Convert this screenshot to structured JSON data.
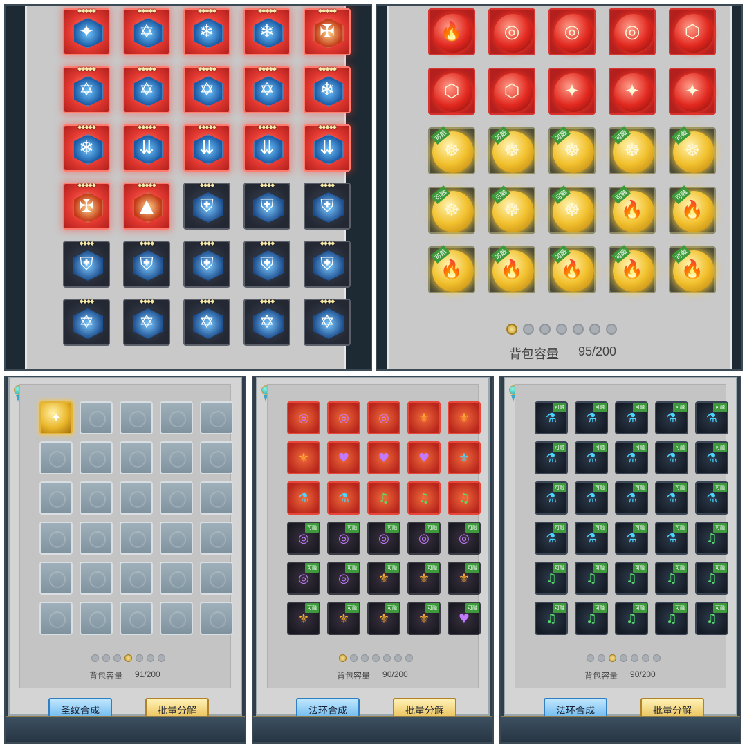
{
  "panels": {
    "p1": {
      "tiles": [
        {
          "style": "red",
          "symbol": "✦",
          "stars": "◆◆◆◆◆"
        },
        {
          "style": "red",
          "symbol": "✡",
          "stars": "◆◆◆◆◆"
        },
        {
          "style": "red",
          "symbol": "❄",
          "stars": "◆◆◆◆◆"
        },
        {
          "style": "red",
          "symbol": "❄",
          "stars": "◆◆◆◆◆"
        },
        {
          "style": "redfire",
          "symbol": "✠",
          "stars": "◆◆◆◆◆"
        },
        {
          "style": "red",
          "symbol": "✡",
          "stars": "◆◆◆◆◆"
        },
        {
          "style": "red",
          "symbol": "✡",
          "stars": "◆◆◆◆◆"
        },
        {
          "style": "red",
          "symbol": "✡",
          "stars": "◆◆◆◆◆"
        },
        {
          "style": "red",
          "symbol": "✡",
          "stars": "◆◆◆◆◆"
        },
        {
          "style": "red",
          "symbol": "❄",
          "stars": "◆◆◆◆◆"
        },
        {
          "style": "red",
          "symbol": "❄",
          "stars": "◆◆◆◆◆"
        },
        {
          "style": "red",
          "symbol": "⇊",
          "stars": "◆◆◆◆◆"
        },
        {
          "style": "red",
          "symbol": "⇊",
          "stars": "◆◆◆◆◆"
        },
        {
          "style": "red",
          "symbol": "⇊",
          "stars": "◆◆◆◆◆"
        },
        {
          "style": "red",
          "symbol": "⇊",
          "stars": "◆◆◆◆◆"
        },
        {
          "style": "redfire",
          "symbol": "✠",
          "stars": "◆◆◆◆◆"
        },
        {
          "style": "redfire",
          "symbol": "▲",
          "stars": "◆◆◆◆◆"
        },
        {
          "style": "dark",
          "symbol": "⛨",
          "stars": "◆◆◆◆"
        },
        {
          "style": "dark",
          "symbol": "⛨",
          "stars": "◆◆◆◆"
        },
        {
          "style": "dark",
          "symbol": "⛨",
          "stars": "◆◆◆◆"
        },
        {
          "style": "dark",
          "symbol": "⛨",
          "stars": "◆◆◆◆"
        },
        {
          "style": "dark",
          "symbol": "⛨",
          "stars": "◆◆◆◆"
        },
        {
          "style": "dark",
          "symbol": "⛨",
          "stars": "◆◆◆◆"
        },
        {
          "style": "dark",
          "symbol": "⛨",
          "stars": "◆◆◆◆"
        },
        {
          "style": "dark",
          "symbol": "⛨",
          "stars": "◆◆◆◆"
        },
        {
          "style": "dark",
          "symbol": "✡",
          "stars": "◆◆◆◆"
        },
        {
          "style": "dark",
          "symbol": "✡",
          "stars": "◆◆◆◆"
        },
        {
          "style": "dark",
          "symbol": "✡",
          "stars": "◆◆◆◆"
        },
        {
          "style": "dark",
          "symbol": "✡",
          "stars": "◆◆◆◆"
        },
        {
          "style": "dark",
          "symbol": "✡",
          "stars": "◆◆◆◆"
        }
      ]
    },
    "p2": {
      "tiles": [
        {
          "style": "redorb",
          "symbol": "🔥"
        },
        {
          "style": "redorb",
          "symbol": "◎"
        },
        {
          "style": "redorb",
          "symbol": "◎"
        },
        {
          "style": "redorb",
          "symbol": "◎"
        },
        {
          "style": "redorb",
          "symbol": "⬡"
        },
        {
          "style": "redorb",
          "symbol": "⬡"
        },
        {
          "style": "redorb",
          "symbol": "⬡"
        },
        {
          "style": "redorb",
          "symbol": "✦"
        },
        {
          "style": "redorb",
          "symbol": "✦"
        },
        {
          "style": "redorb",
          "symbol": "✦"
        },
        {
          "style": "goldorb",
          "symbol": "☸",
          "tag": "可融"
        },
        {
          "style": "goldorb",
          "symbol": "☸",
          "tag": "可融"
        },
        {
          "style": "goldorb",
          "symbol": "☸",
          "tag": "可融"
        },
        {
          "style": "goldorb",
          "symbol": "☸",
          "tag": "可融"
        },
        {
          "style": "goldorb",
          "symbol": "☸",
          "tag": "可融"
        },
        {
          "style": "goldorb",
          "symbol": "☸",
          "tag": "可融"
        },
        {
          "style": "goldorb",
          "symbol": "☸",
          "tag": "可融"
        },
        {
          "style": "goldorb",
          "symbol": "☸",
          "tag": "可融"
        },
        {
          "style": "goldorb",
          "symbol": "🔥",
          "tag": "可融"
        },
        {
          "style": "goldorb",
          "symbol": "🔥",
          "tag": "可融"
        },
        {
          "style": "goldorb",
          "symbol": "🔥",
          "tag": "可融"
        },
        {
          "style": "goldorb",
          "symbol": "🔥",
          "tag": "可融"
        },
        {
          "style": "goldorb",
          "symbol": "🔥",
          "tag": "可融"
        },
        {
          "style": "goldorb",
          "symbol": "🔥",
          "tag": "可融"
        },
        {
          "style": "goldorb",
          "symbol": "🔥",
          "tag": "可融"
        }
      ],
      "pager_active": 0,
      "pager_count": 7,
      "capacity_label": "背包容量",
      "capacity_value": "95/200"
    },
    "p3": {
      "tiles": [
        {
          "style": "s-gold",
          "symbol": "✦",
          "color": "c-white"
        },
        {
          "style": "empty"
        },
        {
          "style": "empty"
        },
        {
          "style": "empty"
        },
        {
          "style": "empty"
        },
        {
          "style": "empty"
        },
        {
          "style": "empty"
        },
        {
          "style": "empty"
        },
        {
          "style": "empty"
        },
        {
          "style": "empty"
        },
        {
          "style": "empty"
        },
        {
          "style": "empty"
        },
        {
          "style": "empty"
        },
        {
          "style": "empty"
        },
        {
          "style": "empty"
        },
        {
          "style": "empty"
        },
        {
          "style": "empty"
        },
        {
          "style": "empty"
        },
        {
          "style": "empty"
        },
        {
          "style": "empty"
        },
        {
          "style": "empty"
        },
        {
          "style": "empty"
        },
        {
          "style": "empty"
        },
        {
          "style": "empty"
        },
        {
          "style": "empty"
        },
        {
          "style": "empty"
        },
        {
          "style": "empty"
        },
        {
          "style": "empty"
        },
        {
          "style": "empty"
        },
        {
          "style": "empty"
        }
      ],
      "pager_active": 3,
      "pager_count": 7,
      "capacity_label": "背包容量",
      "capacity_value": "91/200",
      "left_button": "圣纹合成",
      "right_button": "批量分解"
    },
    "p4": {
      "tiles": [
        {
          "style": "s-red",
          "symbol": "◎",
          "color": "c-purple"
        },
        {
          "style": "s-red",
          "symbol": "◎",
          "color": "c-purple"
        },
        {
          "style": "s-red",
          "symbol": "◎",
          "color": "c-purple"
        },
        {
          "style": "s-red",
          "symbol": "⚜",
          "color": "c-orange"
        },
        {
          "style": "s-red",
          "symbol": "⚜",
          "color": "c-orange"
        },
        {
          "style": "s-red",
          "symbol": "⚜",
          "color": "c-orange"
        },
        {
          "style": "s-red",
          "symbol": "♥",
          "color": "c-purple"
        },
        {
          "style": "s-red",
          "symbol": "♥",
          "color": "c-purple"
        },
        {
          "style": "s-red",
          "symbol": "♥",
          "color": "c-purple"
        },
        {
          "style": "s-red",
          "symbol": "⚜",
          "color": "c-teal"
        },
        {
          "style": "s-red",
          "symbol": "⚗",
          "color": "c-teal"
        },
        {
          "style": "s-red",
          "symbol": "⚗",
          "color": "c-teal"
        },
        {
          "style": "s-red",
          "symbol": "♫",
          "color": "c-green"
        },
        {
          "style": "s-red",
          "symbol": "♫",
          "color": "c-green"
        },
        {
          "style": "s-red",
          "symbol": "♫",
          "color": "c-green"
        },
        {
          "style": "s-dark",
          "symbol": "◎",
          "color": "c-purple",
          "tag": "可融"
        },
        {
          "style": "s-dark",
          "symbol": "◎",
          "color": "c-purple",
          "tag": "可融"
        },
        {
          "style": "s-dark",
          "symbol": "◎",
          "color": "c-purple",
          "tag": "可融"
        },
        {
          "style": "s-dark",
          "symbol": "◎",
          "color": "c-purple",
          "tag": "可融"
        },
        {
          "style": "s-dark",
          "symbol": "◎",
          "color": "c-purple",
          "tag": "可融"
        },
        {
          "style": "s-dark",
          "symbol": "◎",
          "color": "c-purple",
          "tag": "可融"
        },
        {
          "style": "s-dark",
          "symbol": "◎",
          "color": "c-purple",
          "tag": "可融"
        },
        {
          "style": "s-dark",
          "symbol": "⚜",
          "color": "c-orange",
          "tag": "可融"
        },
        {
          "style": "s-dark",
          "symbol": "⚜",
          "color": "c-orange",
          "tag": "可融"
        },
        {
          "style": "s-dark",
          "symbol": "⚜",
          "color": "c-orange",
          "tag": "可融"
        },
        {
          "style": "s-dark",
          "symbol": "⚜",
          "color": "c-orange",
          "tag": "可融"
        },
        {
          "style": "s-dark",
          "symbol": "⚜",
          "color": "c-orange",
          "tag": "可融"
        },
        {
          "style": "s-dark",
          "symbol": "⚜",
          "color": "c-orange",
          "tag": "可融"
        },
        {
          "style": "s-dark",
          "symbol": "⚜",
          "color": "c-orange",
          "tag": "可融"
        },
        {
          "style": "s-dark",
          "symbol": "♥",
          "color": "c-purple",
          "tag": "可融"
        }
      ],
      "pager_active": 0,
      "pager_count": 7,
      "capacity_label": "背包容量",
      "capacity_value": "90/200",
      "left_button": "法环合成",
      "right_button": "批量分解"
    },
    "p5": {
      "tiles": [
        {
          "style": "s-blue",
          "symbol": "⚗",
          "color": "c-teal",
          "tag": "可融"
        },
        {
          "style": "s-blue",
          "symbol": "⚗",
          "color": "c-teal",
          "tag": "可融"
        },
        {
          "style": "s-blue",
          "symbol": "⚗",
          "color": "c-teal",
          "tag": "可融"
        },
        {
          "style": "s-blue",
          "symbol": "⚗",
          "color": "c-teal",
          "tag": "可融"
        },
        {
          "style": "s-blue",
          "symbol": "⚗",
          "color": "c-teal",
          "tag": "可融"
        },
        {
          "style": "s-blue",
          "symbol": "⚗",
          "color": "c-teal",
          "tag": "可融"
        },
        {
          "style": "s-blue",
          "symbol": "⚗",
          "color": "c-teal",
          "tag": "可融"
        },
        {
          "style": "s-blue",
          "symbol": "⚗",
          "color": "c-teal",
          "tag": "可融"
        },
        {
          "style": "s-blue",
          "symbol": "⚗",
          "color": "c-teal",
          "tag": "可融"
        },
        {
          "style": "s-blue",
          "symbol": "⚗",
          "color": "c-teal",
          "tag": "可融"
        },
        {
          "style": "s-blue",
          "symbol": "⚗",
          "color": "c-teal",
          "tag": "可融"
        },
        {
          "style": "s-blue",
          "symbol": "⚗",
          "color": "c-teal",
          "tag": "可融"
        },
        {
          "style": "s-blue",
          "symbol": "⚗",
          "color": "c-teal",
          "tag": "可融"
        },
        {
          "style": "s-blue",
          "symbol": "⚗",
          "color": "c-teal",
          "tag": "可融"
        },
        {
          "style": "s-blue",
          "symbol": "⚗",
          "color": "c-teal",
          "tag": "可融"
        },
        {
          "style": "s-blue",
          "symbol": "⚗",
          "color": "c-teal",
          "tag": "可融"
        },
        {
          "style": "s-blue",
          "symbol": "⚗",
          "color": "c-teal",
          "tag": "可融"
        },
        {
          "style": "s-blue",
          "symbol": "⚗",
          "color": "c-teal",
          "tag": "可融"
        },
        {
          "style": "s-blue",
          "symbol": "⚗",
          "color": "c-teal",
          "tag": "可融"
        },
        {
          "style": "s-blue",
          "symbol": "♫",
          "color": "c-green",
          "tag": "可融"
        },
        {
          "style": "s-blue",
          "symbol": "♫",
          "color": "c-green",
          "tag": "可融"
        },
        {
          "style": "s-blue",
          "symbol": "♫",
          "color": "c-green",
          "tag": "可融"
        },
        {
          "style": "s-blue",
          "symbol": "♫",
          "color": "c-green",
          "tag": "可融"
        },
        {
          "style": "s-blue",
          "symbol": "♫",
          "color": "c-green",
          "tag": "可融"
        },
        {
          "style": "s-blue",
          "symbol": "♫",
          "color": "c-green",
          "tag": "可融"
        },
        {
          "style": "s-blue",
          "symbol": "♫",
          "color": "c-green",
          "tag": "可融"
        },
        {
          "style": "s-blue",
          "symbol": "♫",
          "color": "c-green",
          "tag": "可融"
        },
        {
          "style": "s-blue",
          "symbol": "♫",
          "color": "c-green",
          "tag": "可融"
        },
        {
          "style": "s-blue",
          "symbol": "♫",
          "color": "c-green",
          "tag": "可融"
        },
        {
          "style": "s-blue",
          "symbol": "♫",
          "color": "c-green",
          "tag": "可融"
        }
      ],
      "pager_active": 2,
      "pager_count": 7,
      "capacity_label": "背包容量",
      "capacity_value": "90/200",
      "left_button": "法环合成",
      "right_button": "批量分解"
    }
  }
}
